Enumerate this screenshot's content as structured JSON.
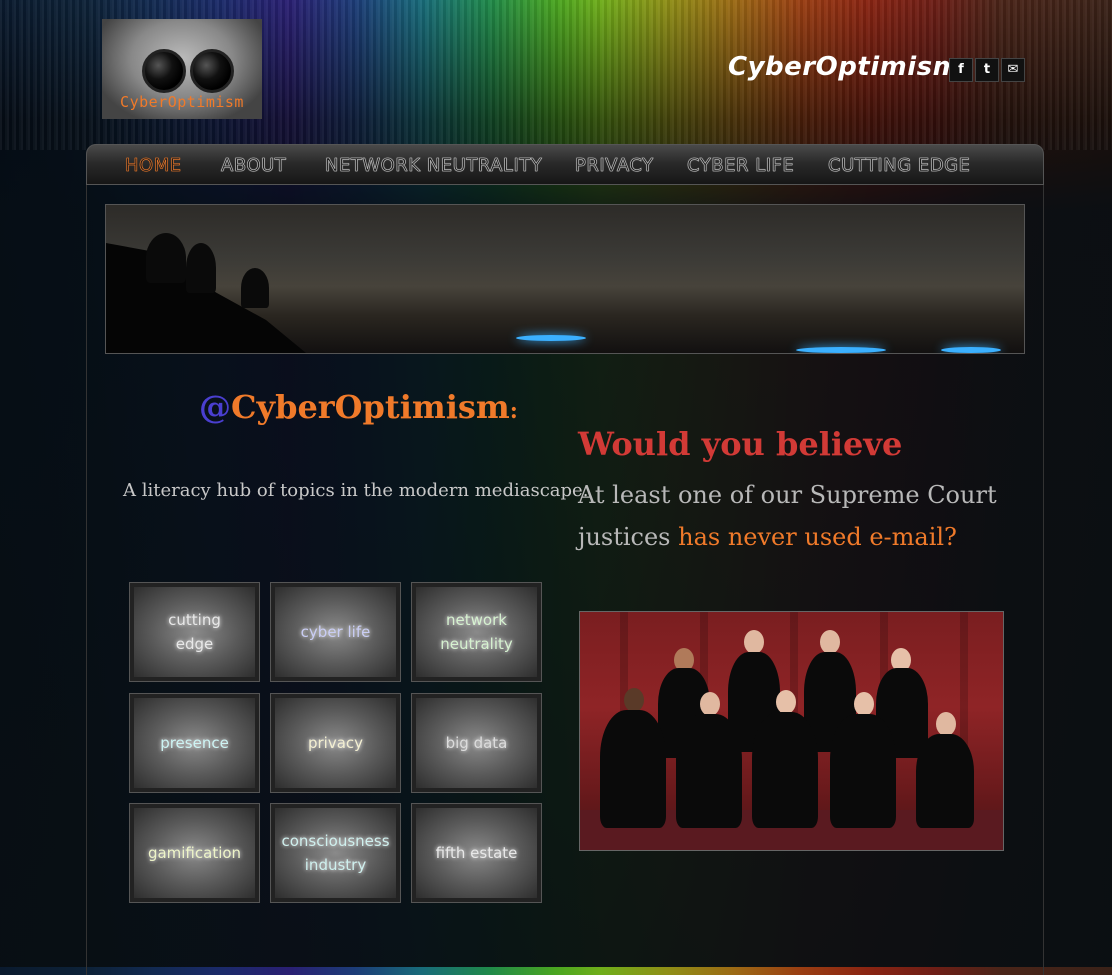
{
  "header": {
    "logo_text": "CyberOptimism",
    "site_title": "CyberOptimism",
    "social": [
      {
        "icon": "facebook-icon",
        "glyph": "f"
      },
      {
        "icon": "twitter-icon",
        "glyph": "t"
      },
      {
        "icon": "email-icon",
        "glyph": "✉"
      }
    ]
  },
  "nav": {
    "items": [
      "Home",
      "About",
      "Network Neutrality",
      "Privacy",
      "Cyber Life",
      "Cutting Edge"
    ],
    "active": "Home"
  },
  "main": {
    "handle_at": "@",
    "handle_name": "CyberOptimism",
    "handle_colon": ":",
    "tagline": "A literacy hub of topics in the modern mediascape.",
    "headline": "Would you believe",
    "body_prefix": "At least one of our Supreme Court justices ",
    "body_highlight": "has never used e-mail?"
  },
  "tiles": [
    "cutting edge",
    "cyber life",
    "network neutrality",
    "presence",
    "privacy",
    "big data",
    "gamification",
    "consciousness industry",
    "fifth estate"
  ],
  "colors": {
    "accent_orange": "#f07a2a",
    "headline_red": "#d23a36",
    "handle_at_blue": "#4a3fd0"
  }
}
